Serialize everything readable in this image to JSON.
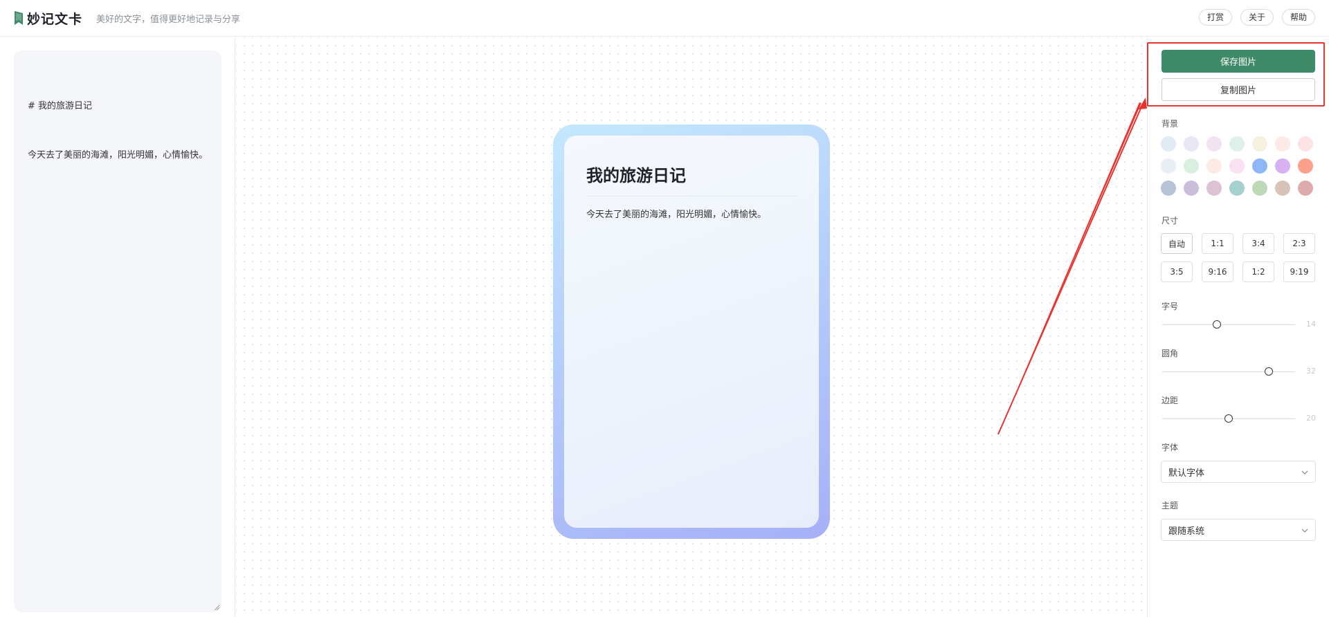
{
  "header": {
    "app_title": "妙记文卡",
    "subtitle": "美好的文字，值得更好地记录与分享",
    "actions": [
      {
        "label": "打赏"
      },
      {
        "label": "关于"
      },
      {
        "label": "帮助"
      }
    ]
  },
  "editor": {
    "line1": "# 我的旅游日记",
    "line2": "今天去了美丽的海滩，阳光明媚，心情愉快。"
  },
  "card": {
    "title": "我的旅游日记",
    "body": "今天去了美丽的海滩，阳光明媚，心情愉快。"
  },
  "panel": {
    "save_label": "保存图片",
    "copy_label": "复制图片",
    "background_label": "背景",
    "swatches": [
      "#e2ebf5",
      "#e9e6f6",
      "#f3e2f2",
      "#dff0e9",
      "#f5f1de",
      "#fbebe4",
      "#fde3e3",
      "#e9eef6",
      "#d7f0e0",
      "#feeae2",
      "#f9e2f1",
      "#8fb6f7",
      "#d8b1f2",
      "#fca08c",
      "#b6c2d6",
      "#cbbedc",
      "#dcc2d3",
      "#a6cfcf",
      "#bcd9b5",
      "#d9c2b8",
      "#dbacab"
    ],
    "size_label": "尺寸",
    "sizes": [
      "自动",
      "1:1",
      "3:4",
      "2:3",
      "3:5",
      "9:16",
      "1:2",
      "9:19"
    ],
    "font_size_label": "字号",
    "font_size_value": "14",
    "font_size_fraction": 0.41,
    "radius_label": "圆角",
    "radius_value": "32",
    "radius_fraction": 0.8,
    "padding_label": "边距",
    "padding_value": "20",
    "padding_fraction": 0.5,
    "font_label": "字体",
    "font_value": "默认字体",
    "theme_label": "主题",
    "theme_value": "跟随系统"
  },
  "colors": {
    "accent": "#3f8a68",
    "highlight": "#e8322d"
  }
}
